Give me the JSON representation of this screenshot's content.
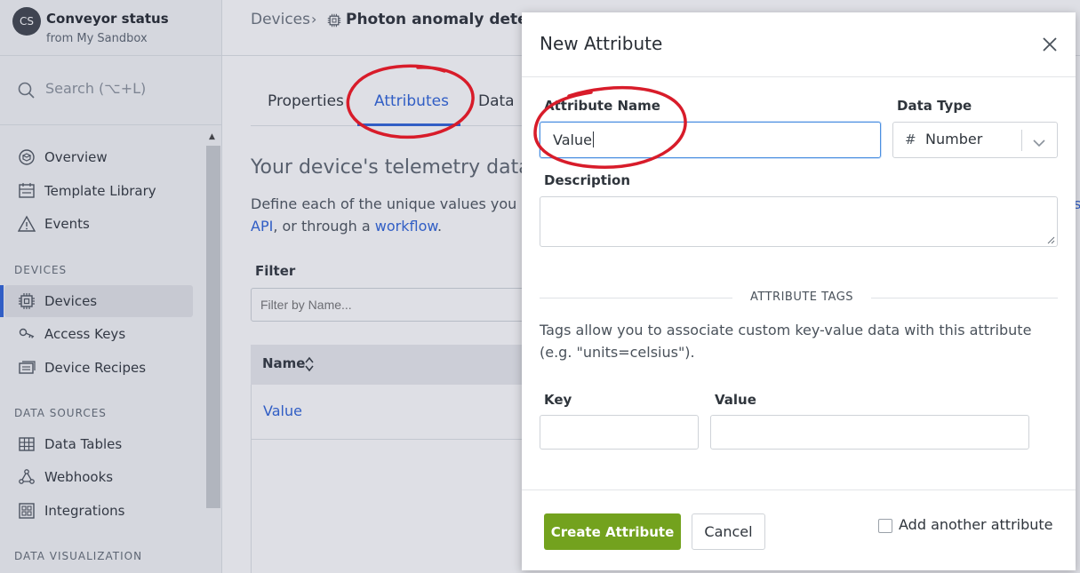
{
  "app": {
    "avatar_initials": "CS",
    "title": "Conveyor status",
    "subtitle": "from My Sandbox"
  },
  "search": {
    "placeholder": "Search (⌥+L)"
  },
  "sidebar": {
    "items_top": [
      {
        "label": "Overview",
        "icon": "overview-icon"
      },
      {
        "label": "Template Library",
        "icon": "template-icon"
      },
      {
        "label": "Events",
        "icon": "warning-icon"
      }
    ],
    "devices_section": "DEVICES",
    "devices_items": [
      {
        "label": "Devices",
        "icon": "chip-icon",
        "active": true
      },
      {
        "label": "Access Keys",
        "icon": "key-icon"
      },
      {
        "label": "Device Recipes",
        "icon": "recipe-icon"
      }
    ],
    "data_sources_section": "DATA SOURCES",
    "data_sources_items": [
      {
        "label": "Data Tables",
        "icon": "table-icon"
      },
      {
        "label": "Webhooks",
        "icon": "webhook-icon"
      },
      {
        "label": "Integrations",
        "icon": "integrations-icon"
      }
    ],
    "data_viz_section": "DATA VISUALIZATION"
  },
  "breadcrumb": {
    "parent": "Devices",
    "separator": "›",
    "current": "Photon anomaly detection"
  },
  "tabs": [
    "Properties",
    "Attributes",
    "Data"
  ],
  "active_tab": "Attributes",
  "content": {
    "title": "Your device's telemetry data",
    "desc_line1": "Define each of the unique values you w",
    "desc_api": "API",
    "desc_mid": ", or through a ",
    "desc_workflow": "workflow",
    "desc_end": ".",
    "filter_label": "Filter",
    "filter_placeholder": "Filter by Name...",
    "table_header_name": "Name",
    "rows": [
      "Value"
    ],
    "edge_char": "s"
  },
  "modal": {
    "title": "New Attribute",
    "attribute_name_label": "Attribute Name",
    "attribute_name_value": "Value",
    "data_type_label": "Data Type",
    "data_type_value": "Number",
    "data_type_symbol": "#",
    "description_label": "Description",
    "description_value": "",
    "tags_section": "ATTRIBUTE TAGS",
    "tags_description": "Tags allow you to associate custom key-value data with this attribute (e.g. \"units=celsius\").",
    "key_label": "Key",
    "value_label": "Value",
    "create_button": "Create Attribute",
    "cancel_button": "Cancel",
    "add_another_label": "Add another attribute",
    "add_another_checked": false
  },
  "colors": {
    "accent": "#2c62d8",
    "primary_button": "#73a21e",
    "annotation": "#d81c2a"
  }
}
